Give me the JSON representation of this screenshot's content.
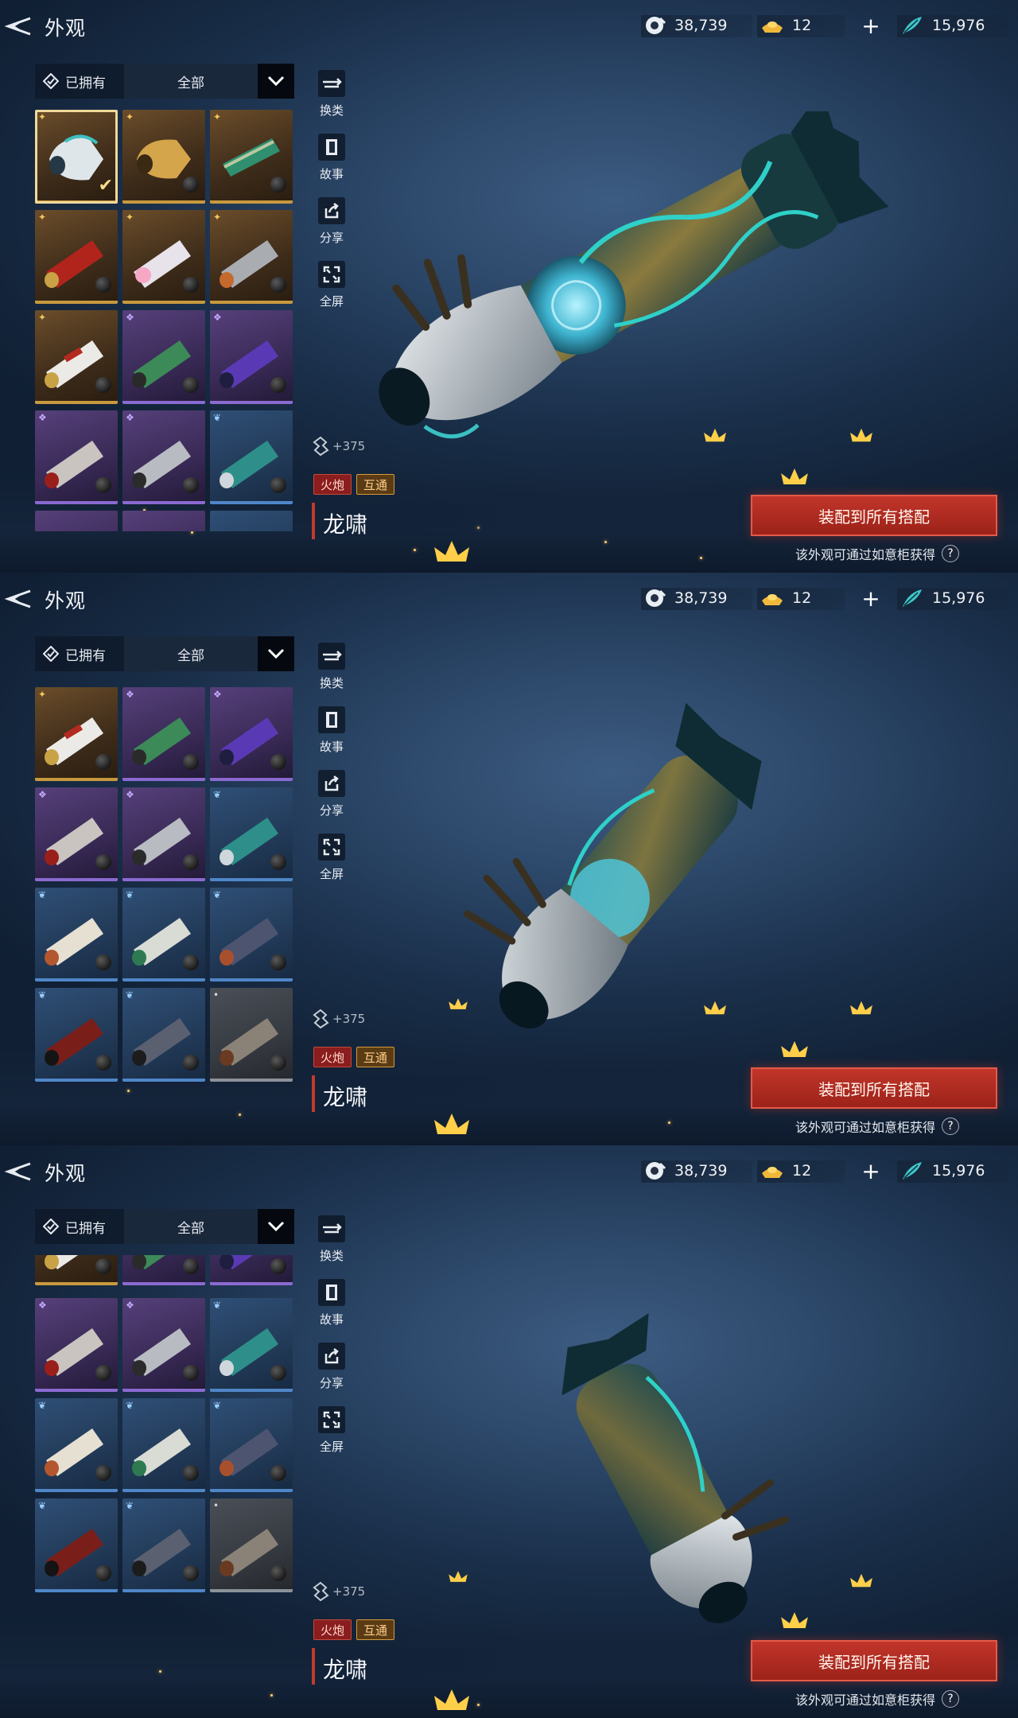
{
  "header": {
    "title": "外观",
    "currencies": [
      {
        "icon": "jade-coin-icon",
        "value": "38,739"
      },
      {
        "icon": "gold-ingot-icon",
        "value": "12"
      },
      {
        "icon": "feather-token-icon",
        "value": "15,976"
      }
    ]
  },
  "filter": {
    "owned_label": "已拥有",
    "category_value": "全部"
  },
  "actions": [
    {
      "icon": "swap-category-icon",
      "label": "换类"
    },
    {
      "icon": "story-book-icon",
      "label": "故事"
    },
    {
      "icon": "share-icon",
      "label": "分享"
    },
    {
      "icon": "fullscreen-icon",
      "label": "全屏"
    }
  ],
  "item": {
    "score": "+375",
    "tags": [
      "火炮",
      "互通"
    ],
    "name": "龙啸"
  },
  "equip_button_label": "装配到所有搭配",
  "hint_text": "该外观可通过如意柜获得",
  "help_label": "?",
  "colors": {
    "gold_rarity": "#c8993e",
    "purple_rarity": "#8a6ad0",
    "blue_rarity": "#4f86c8",
    "gray_rarity": "#8c929a",
    "equip_button": "#c2352a"
  }
}
